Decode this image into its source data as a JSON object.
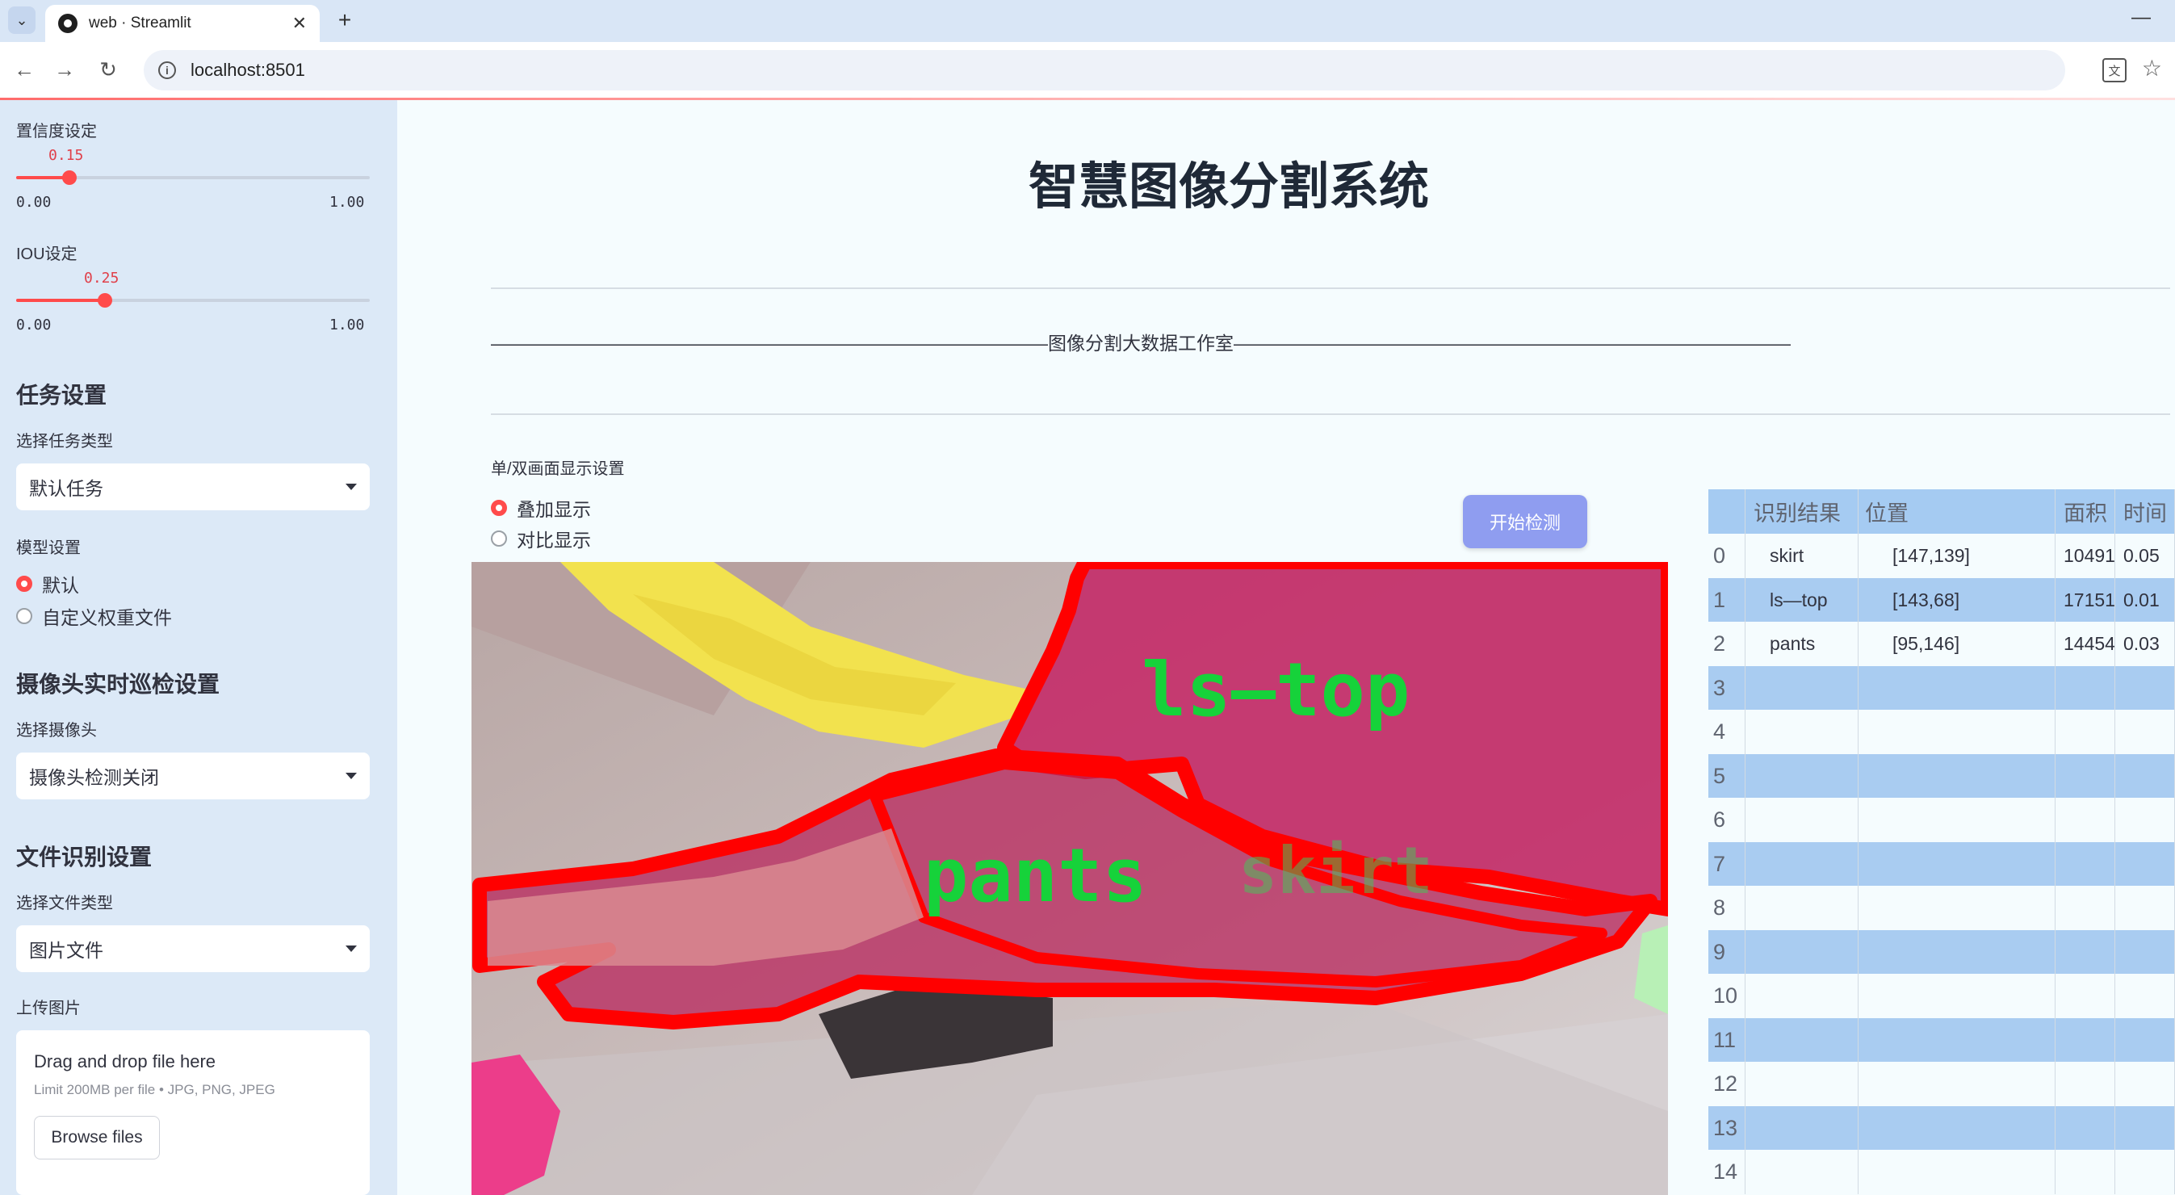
{
  "browser": {
    "tab_title": "web · Streamlit",
    "url": "localhost:8501"
  },
  "sidebar": {
    "confidence": {
      "label": "置信度设定",
      "value": "0.15",
      "min": "0.00",
      "max": "1.00",
      "fraction": 0.15
    },
    "iou": {
      "label": "IOU设定",
      "value": "0.25",
      "min": "0.00",
      "max": "1.00",
      "fraction": 0.25
    },
    "task_heading": "任务设置",
    "task_type_label": "选择任务类型",
    "task_type_value": "默认任务",
    "model_label": "模型设置",
    "model_options": [
      "默认",
      "自定义权重文件"
    ],
    "camera_heading": "摄像头实时巡检设置",
    "camera_label": "选择摄像头",
    "camera_value": "摄像头检测关闭",
    "file_heading": "文件识别设置",
    "file_type_label": "选择文件类型",
    "file_type_value": "图片文件",
    "upload_label": "上传图片",
    "upload_title": "Drag and drop file here",
    "upload_limit": "Limit 200MB per file • JPG, PNG, JPEG",
    "browse_label": "Browse files"
  },
  "main": {
    "title": "智慧图像分割系统",
    "divider_text": "——————————————————————————————图像分割大数据工作室——————————————————————————————",
    "display_label": "单/双画面显示设置",
    "display_options": [
      "叠加显示",
      "对比显示"
    ],
    "start_button": "开始检测",
    "image_labels": {
      "top": "ls—top",
      "pants": "pants",
      "skirt": "skirt"
    }
  },
  "table": {
    "headers": [
      "识别结果",
      "位置",
      "面积",
      "时间"
    ],
    "rows": [
      {
        "idx": "0",
        "result": "skirt",
        "pos": "[147,139]",
        "area": "10491",
        "time": "0.05"
      },
      {
        "idx": "1",
        "result": "ls—top",
        "pos": "[143,68]",
        "area": "17151",
        "time": "0.01"
      },
      {
        "idx": "2",
        "result": "pants",
        "pos": "[95,146]",
        "area": "14454",
        "time": "0.03"
      },
      {
        "idx": "3"
      },
      {
        "idx": "4"
      },
      {
        "idx": "5"
      },
      {
        "idx": "6"
      },
      {
        "idx": "7"
      },
      {
        "idx": "8"
      },
      {
        "idx": "9"
      },
      {
        "idx": "10"
      },
      {
        "idx": "11"
      },
      {
        "idx": "12"
      },
      {
        "idx": "13"
      },
      {
        "idx": "14"
      }
    ]
  }
}
